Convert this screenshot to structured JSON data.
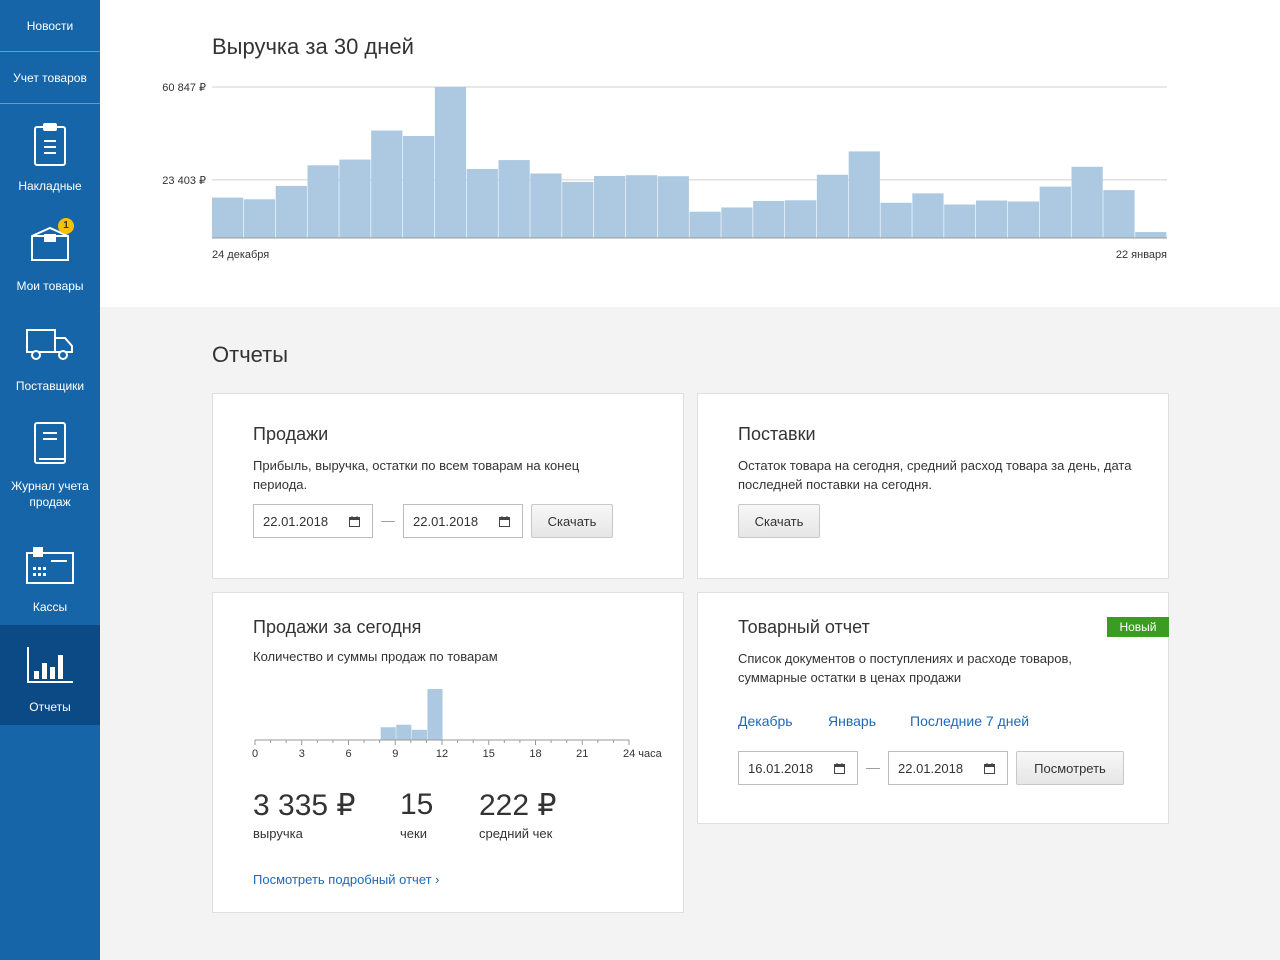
{
  "sidebar": {
    "items": [
      {
        "label": "Новости"
      },
      {
        "label": "Учет товаров"
      },
      {
        "label": "Накладные"
      },
      {
        "label": "Мои товары",
        "badge": "1"
      },
      {
        "label": "Поставщики"
      },
      {
        "label": "Журнал учета продаж"
      },
      {
        "label": "Кассы"
      },
      {
        "label": "Отчеты"
      }
    ]
  },
  "revenue": {
    "title": "Выручка за 30 дней",
    "chart_data": {
      "type": "bar",
      "title": "Выручка за 30 дней",
      "ytick_labels": [
        "60 847 ₽",
        "23 403 ₽"
      ],
      "yticks": [
        60847,
        23403
      ],
      "ylim": [
        0,
        60847
      ],
      "x_start_label": "24 декабря",
      "x_end_label": "22 января",
      "values": [
        16300,
        15600,
        21000,
        29300,
        31600,
        43300,
        41100,
        60847,
        27800,
        31400,
        26000,
        22600,
        25000,
        25300,
        24900,
        10600,
        12300,
        14900,
        15200,
        25500,
        34900,
        14200,
        18000,
        13500,
        15100,
        14700,
        20700,
        28700,
        19300,
        2400
      ],
      "color": "#adc9e1",
      "grid": true
    }
  },
  "reports": {
    "title": "Отчеты",
    "sales": {
      "title": "Продажи",
      "desc": "Прибыль, выручка, остатки по всем товарам на конец периода.",
      "date_from": "22.01.2018",
      "date_to": "22.01.2018",
      "dash": "—",
      "button": "Скачать"
    },
    "supplies": {
      "title": "Поставки",
      "desc": "Остаток товара на сегодня, средний расход товара за день, дата последней поставки на сегодня.",
      "button": "Скачать"
    },
    "today": {
      "title": "Продажи за сегодня",
      "desc": "Количество и суммы продаж по товарам",
      "chart_data": {
        "type": "bar",
        "x_tick_labels": [
          "0",
          "3",
          "6",
          "9",
          "12",
          "15",
          "18",
          "21",
          "24 часа"
        ],
        "hours": [
          8,
          9,
          10,
          11
        ],
        "values": [
          0.25,
          0.3,
          0.2,
          1.0
        ],
        "color": "#adc9e1"
      },
      "revenue_value": "3 335 ₽",
      "revenue_label": "выручка",
      "checks_value": "15",
      "checks_label": "чеки",
      "avg_value": "222 ₽",
      "avg_label": "средний чек",
      "link": "Посмотреть подробный отчет ›"
    },
    "goods": {
      "title": "Товарный отчет",
      "badge": "Новый",
      "desc": "Список документов о поступлениях и расходе товаров, суммарные остатки в ценах продажи",
      "links": [
        "Декабрь",
        "Январь",
        "Последние 7 дней"
      ],
      "date_from": "16.01.2018",
      "date_to": "22.01.2018",
      "dash": "—",
      "button": "Посмотреть"
    }
  },
  "colors": {
    "sidebar": "#1565a8",
    "sidebar_active": "#0c4a86",
    "bars": "#adc9e1",
    "link": "#1d69b8",
    "badge_new": "#3b9b23",
    "badge_count": "#f6c200"
  }
}
